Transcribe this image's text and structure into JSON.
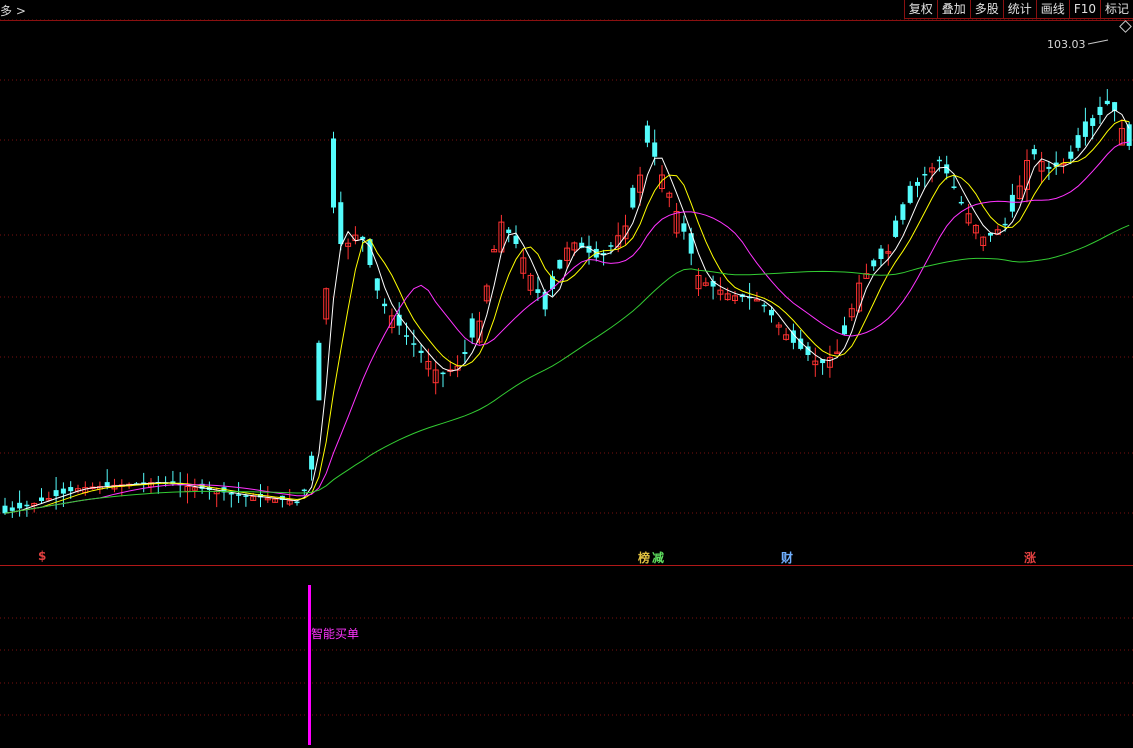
{
  "window": {
    "left_title": "多 >"
  },
  "toolbar": {
    "items": [
      "复权",
      "叠加",
      "多股",
      "统计",
      "画线",
      "F10",
      "标记"
    ]
  },
  "price_label": "103.03",
  "markers": [
    {
      "text": "$",
      "color": "#e04040"
    },
    {
      "text": "榜",
      "color": "#e0c040"
    },
    {
      "text": "减",
      "color": "#60e060"
    },
    {
      "text": "财",
      "color": "#70b0ff"
    },
    {
      "text": "涨",
      "color": "#e04040"
    }
  ],
  "signal_label": "智能买单",
  "colors": {
    "up": "#ff3232",
    "down": "#54fcfc",
    "ma_fast": "#ffffff",
    "ma_mid": "#ffff00",
    "ma_slow": "#ff33ff",
    "ma_long": "#33cc33",
    "grid": "#7a1010",
    "signal": "#ff00ff"
  },
  "icons": [
    "diamond-icon"
  ]
}
